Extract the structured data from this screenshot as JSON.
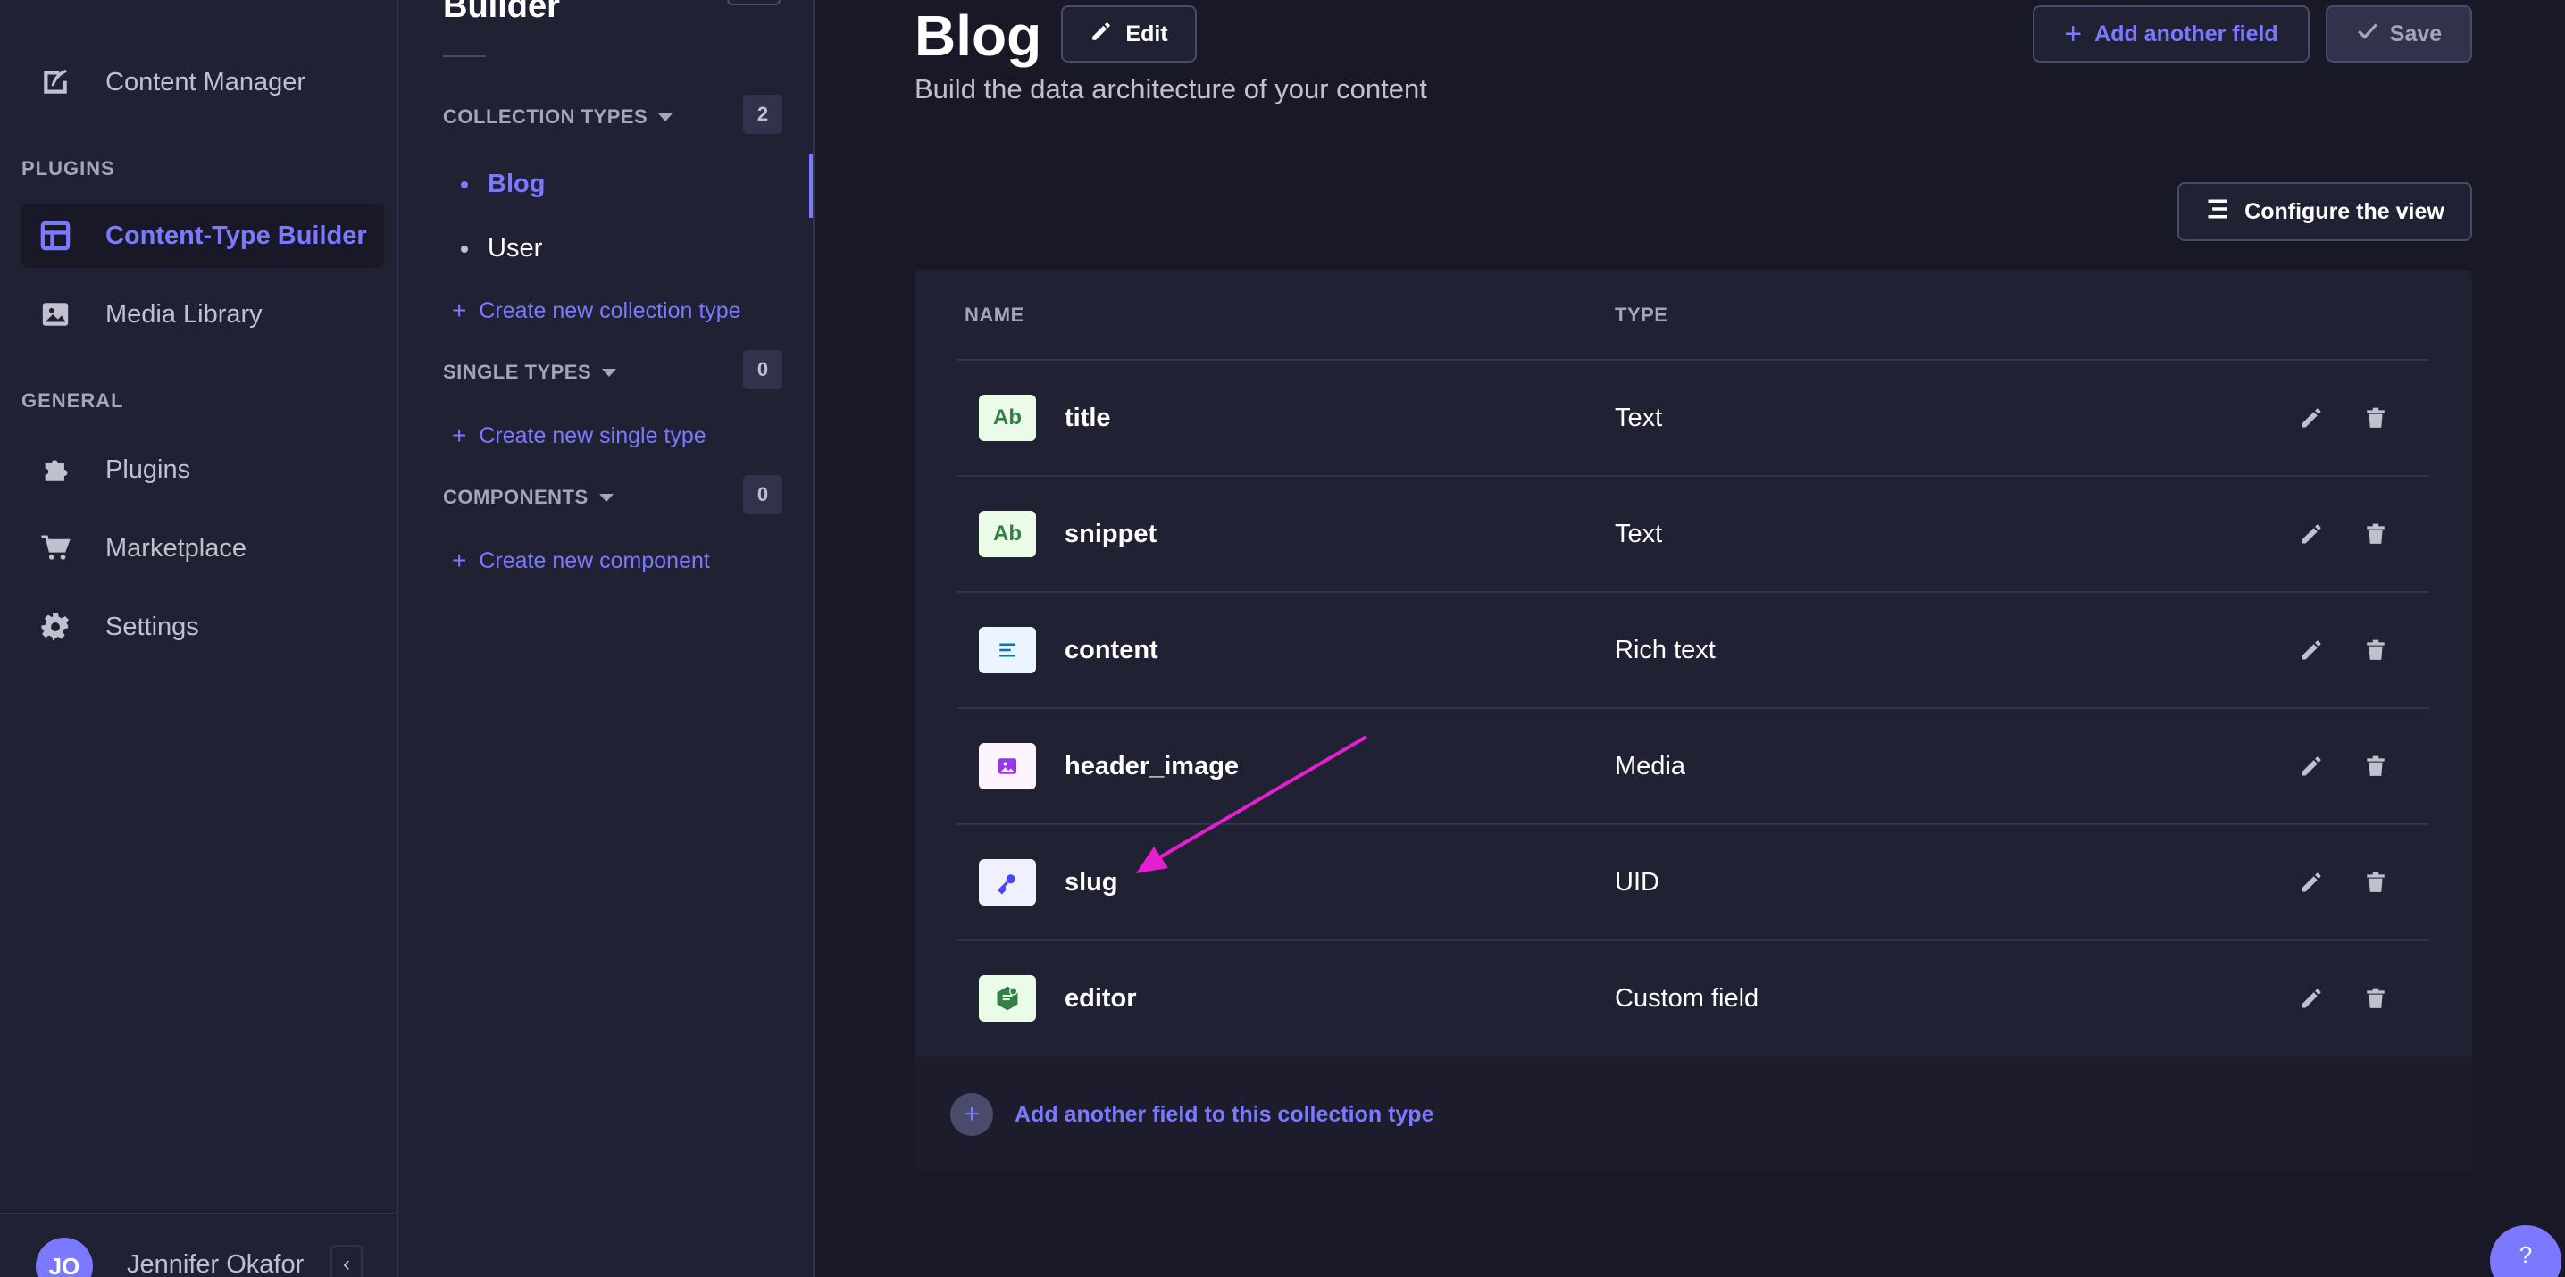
{
  "leftnav": {
    "items_top": [
      {
        "label": "Content Manager",
        "icon": "feather-icon"
      }
    ],
    "plugins_heading": "PLUGINS",
    "plugins": [
      {
        "label": "Content-Type Builder",
        "icon": "layout-icon",
        "active": true
      },
      {
        "label": "Media Library",
        "icon": "image-icon"
      }
    ],
    "general_heading": "GENERAL",
    "general": [
      {
        "label": "Plugins",
        "icon": "puzzle-icon"
      },
      {
        "label": "Marketplace",
        "icon": "cart-icon"
      },
      {
        "label": "Settings",
        "icon": "gear-icon"
      }
    ],
    "user": {
      "initials": "JO",
      "name": "Jennifer Okafor"
    },
    "collapse_glyph": "‹"
  },
  "subnav": {
    "title": "Builder",
    "collection_types": {
      "heading": "COLLECTION TYPES",
      "count": "2",
      "items": [
        "Blog",
        "User"
      ],
      "create_label": "Create new collection type"
    },
    "single_types": {
      "heading": "SINGLE TYPES",
      "count": "0",
      "create_label": "Create new single type"
    },
    "components": {
      "heading": "COMPONENTS",
      "count": "0",
      "create_label": "Create new component"
    }
  },
  "header": {
    "title": "Blog",
    "edit_label": "Edit",
    "subtitle": "Build the data architecture of your content",
    "add_field_label": "Add another field",
    "save_label": "Save",
    "configure_label": "Configure the view"
  },
  "table": {
    "col_name": "NAME",
    "col_type": "TYPE",
    "rows": [
      {
        "name": "title",
        "type": "Text",
        "icon": "Ab",
        "icon_name": "text-field-icon",
        "bg": "#eafbe7",
        "fg": "#328048"
      },
      {
        "name": "snippet",
        "type": "Text",
        "icon": "Ab",
        "icon_name": "text-field-icon",
        "bg": "#eafbe7",
        "fg": "#328048"
      },
      {
        "name": "content",
        "type": "Rich text",
        "icon": "",
        "icon_name": "richtext-field-icon",
        "bg": "#eaf5ff",
        "fg": "#0c75af"
      },
      {
        "name": "header_image",
        "type": "Media",
        "icon": "",
        "icon_name": "media-field-icon",
        "bg": "#fdf4ff",
        "fg": "#9736e8"
      },
      {
        "name": "slug",
        "type": "UID",
        "icon": "",
        "icon_name": "uid-key-icon",
        "bg": "#f0f0ff",
        "fg": "#4945ff"
      },
      {
        "name": "editor",
        "type": "Custom field",
        "icon": "",
        "icon_name": "custom-field-icon",
        "bg": "#eafbe7",
        "fg": "#328048"
      }
    ],
    "footer_label": "Add another field to this collection type"
  },
  "help_label": "?",
  "colors": {
    "accent": "#7b79ff",
    "annotation": "#e61ecf"
  }
}
